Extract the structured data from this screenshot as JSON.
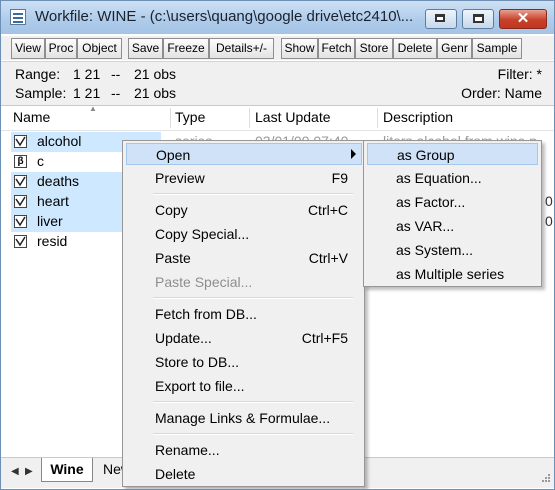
{
  "window": {
    "title": "Workfile: WINE - (c:\\users\\quang\\google drive\\etc2410\\...",
    "minimize_icon": "minimize-icon",
    "maximize_icon": "maximize-icon",
    "close_glyph": "✕"
  },
  "toolbar": {
    "buttons": [
      "View",
      "Proc",
      "Object",
      "Save",
      "Freeze",
      "Details+/-",
      "Show",
      "Fetch",
      "Store",
      "Delete",
      "Genr",
      "Sample"
    ]
  },
  "info": {
    "range_label": "Range:",
    "range_value": "1 21",
    "range_sep": "--",
    "range_obs": "21 obs",
    "sample_label": "Sample:",
    "sample_value": "1 21",
    "sample_sep": "--",
    "sample_obs": "21 obs",
    "filter": "Filter: *",
    "order": "Order: Name"
  },
  "columns": [
    "Name",
    "Type",
    "Last Update",
    "Description"
  ],
  "objects": [
    {
      "name": "alcohol",
      "icon": "series-icon"
    },
    {
      "name": "c",
      "icon": "coef-icon",
      "glyph": "β"
    },
    {
      "name": "deaths",
      "icon": "series-icon"
    },
    {
      "name": "heart",
      "icon": "series-icon"
    },
    {
      "name": "liver",
      "icon": "series-icon"
    },
    {
      "name": "resid",
      "icon": "series-icon"
    }
  ],
  "partial_text": {
    "type_fragment": "series",
    "update_fragment": "03/01/09 07:40",
    "desc_fragment": "liters alcohol from wine p",
    "right_digit_1": "0",
    "right_digit_2": "0"
  },
  "context_menu": {
    "open": "Open",
    "preview": "Preview",
    "preview_shortcut": "F9",
    "copy": "Copy",
    "copy_shortcut": "Ctrl+C",
    "copy_special": "Copy Special...",
    "paste": "Paste",
    "paste_shortcut": "Ctrl+V",
    "paste_special": "Paste Special...",
    "fetch": "Fetch from DB...",
    "update": "Update...",
    "update_shortcut": "Ctrl+F5",
    "store": "Store to DB...",
    "export": "Export to file...",
    "manage": "Manage Links & Formulae...",
    "rename": "Rename...",
    "delete": "Delete"
  },
  "open_submenu": [
    "as Group",
    "as Equation...",
    "as Factor...",
    "as VAR...",
    "as System...",
    "as Multiple series"
  ],
  "tabs": {
    "active": "Wine",
    "other": "New Page"
  },
  "colors": {
    "menu_highlight": "#cfe2f8",
    "selection": "#cde8ff",
    "close_button": "#c7402a"
  }
}
